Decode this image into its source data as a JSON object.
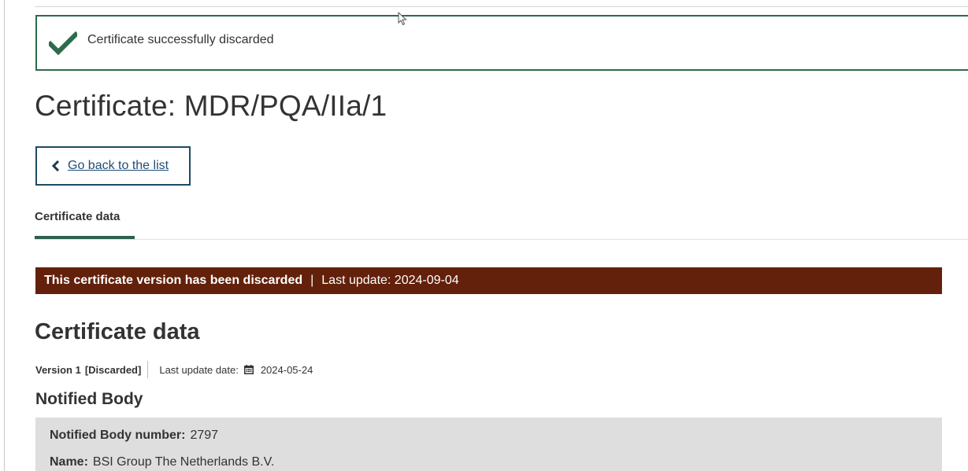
{
  "alert": {
    "message": "Certificate successfully discarded",
    "icon": "checkmark-icon",
    "color": "#2e6b4a"
  },
  "page": {
    "title": "Certificate: MDR/PQA/IIa/1"
  },
  "back_button": {
    "label": "Go back to the list",
    "icon": "chevron-left-icon"
  },
  "tabs": [
    {
      "label": "Certificate data",
      "active": true
    }
  ],
  "discard_banner": {
    "status": "This certificate version has been discarded",
    "separator": "|",
    "last_update": "Last update: 2024-09-04",
    "color": "#63200a"
  },
  "certificate_data": {
    "heading": "Certificate data",
    "version_label": "Version 1",
    "version_status": "[Discarded]",
    "last_update_label": "Last update date:",
    "last_update_icon": "calendar-icon",
    "last_update_date": "2024-05-24"
  },
  "notified_body": {
    "heading": "Notified Body",
    "number_label": "Notified Body number:",
    "number_value": "2797",
    "name_label": "Name:",
    "name_value": "BSI Group The Netherlands B.V."
  }
}
